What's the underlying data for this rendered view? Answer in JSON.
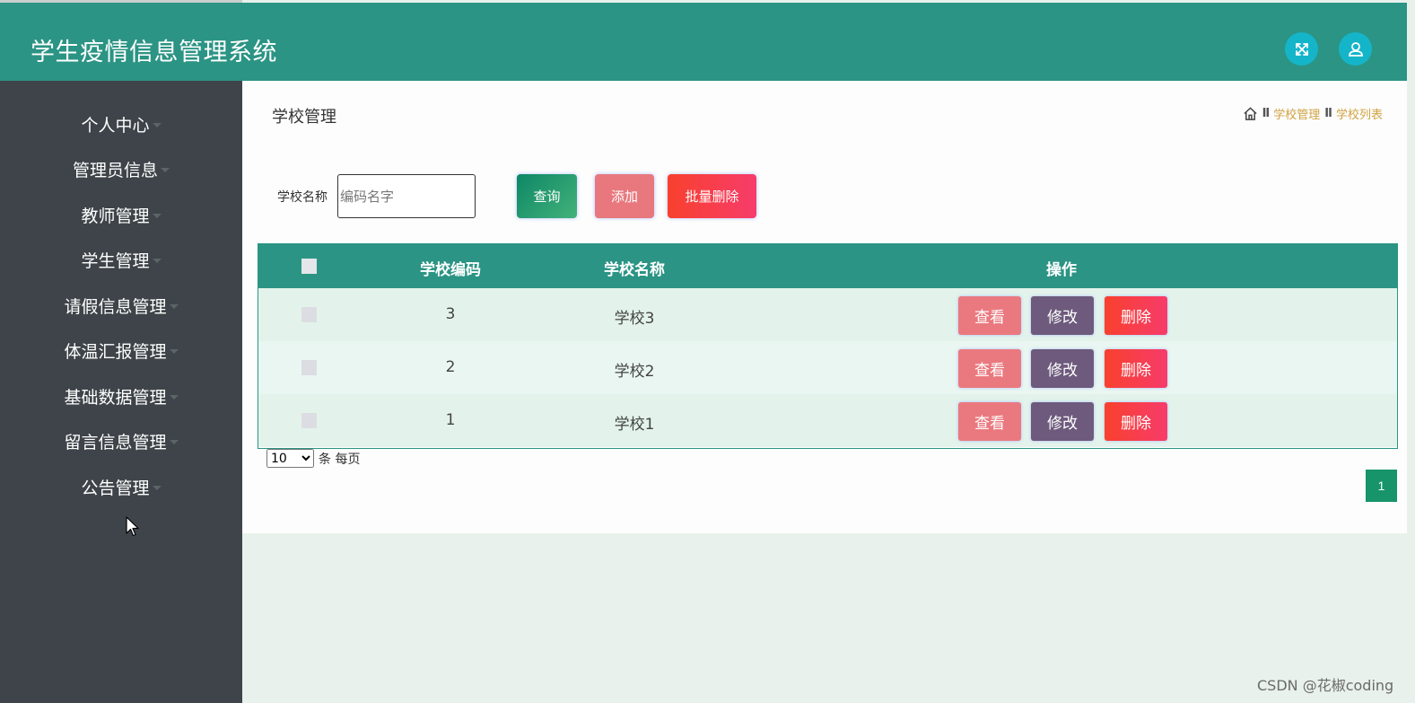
{
  "header": {
    "title": "学生疫情信息管理系统",
    "fullscreen_icon": "expand-arrows-icon",
    "user_icon": "user-icon"
  },
  "sidebar": {
    "items": [
      {
        "label": "个人中心"
      },
      {
        "label": "管理员信息"
      },
      {
        "label": "教师管理"
      },
      {
        "label": "学生管理"
      },
      {
        "label": "请假信息管理"
      },
      {
        "label": "体温汇报管理"
      },
      {
        "label": "基础数据管理"
      },
      {
        "label": "留言信息管理"
      },
      {
        "label": "公告管理"
      }
    ]
  },
  "page": {
    "title": "学校管理",
    "breadcrumb": {
      "home_icon": "home-icon",
      "separator": "II",
      "items": [
        "学校管理",
        "学校列表"
      ]
    }
  },
  "search": {
    "label": "学校名称",
    "placeholder": "编码名字",
    "value": ""
  },
  "toolbar": {
    "query_label": "查询",
    "add_label": "添加",
    "batch_delete_label": "批量删除"
  },
  "table": {
    "headers": [
      "学校编码",
      "学校名称",
      "操作"
    ],
    "rows": [
      {
        "code": "3",
        "name": "学校3"
      },
      {
        "code": "2",
        "name": "学校2"
      },
      {
        "code": "1",
        "name": "学校1"
      }
    ],
    "actions": {
      "view": "查看",
      "edit": "修改",
      "delete": "删除"
    }
  },
  "pagination": {
    "page_size": "10",
    "page_size_options": [
      "10"
    ],
    "per_page_label": "条 每页",
    "current_page": "1"
  },
  "watermark": "CSDN @花椒coding",
  "colors": {
    "header": "#2b9484",
    "sidebar": "#3e4449",
    "accent_gold": "#d1a243",
    "page_active": "#17946a"
  }
}
